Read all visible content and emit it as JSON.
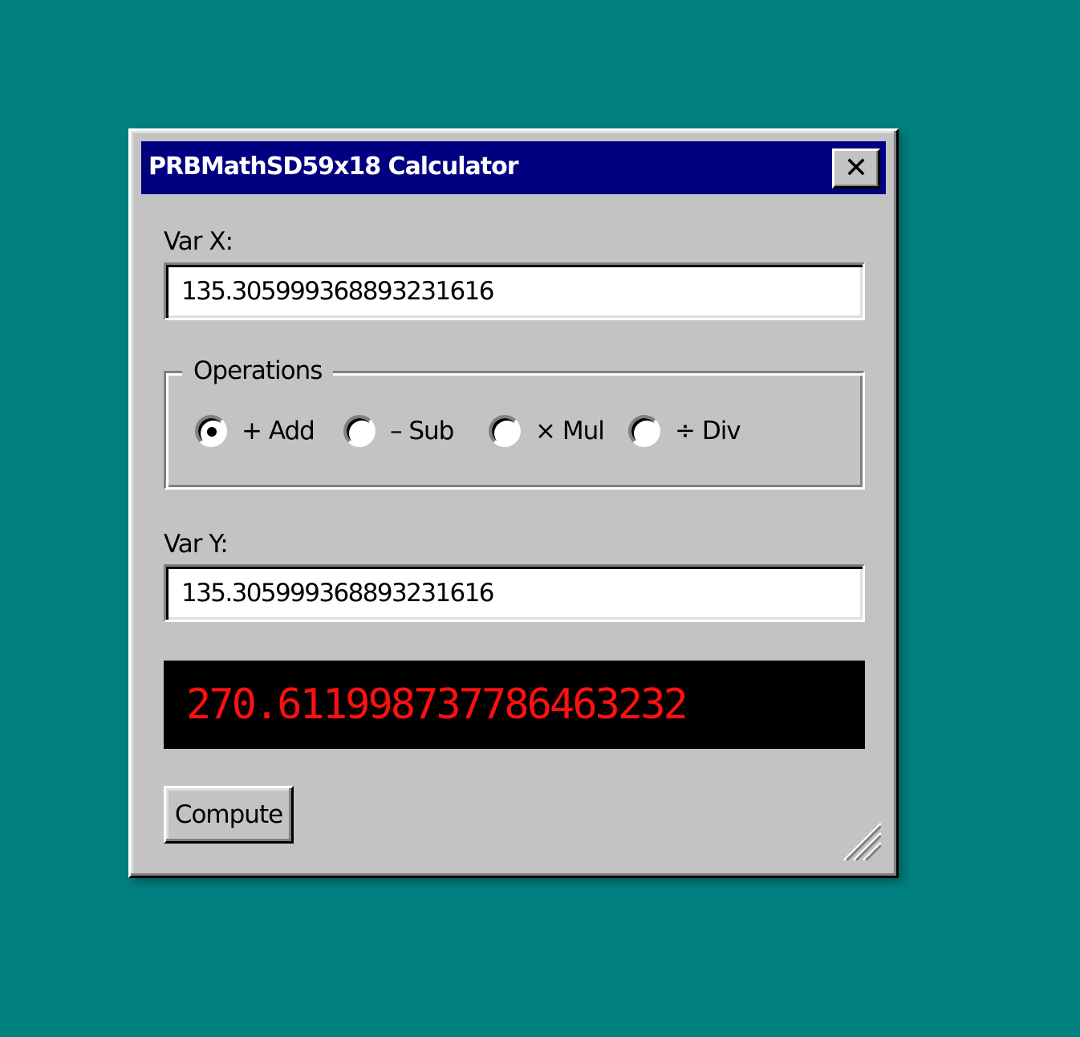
{
  "window": {
    "title": "PRBMathSD59x18 Calculator",
    "close_label": "✕"
  },
  "var_x": {
    "label": "Var X:",
    "value": "135.305999368893231616"
  },
  "operations": {
    "legend": "Operations",
    "selected": "add",
    "options": [
      {
        "id": "add",
        "label": "+ Add"
      },
      {
        "id": "sub",
        "label": "– Sub"
      },
      {
        "id": "mul",
        "label": "× Mul"
      },
      {
        "id": "div",
        "label": "÷ Div"
      }
    ]
  },
  "var_y": {
    "label": "Var Y:",
    "value": "135.305999368893231616"
  },
  "result": {
    "value": "270.611998737786463232"
  },
  "compute_button": {
    "label": "Compute"
  },
  "colors": {
    "desktop": "#008080",
    "titlebar": "#000080",
    "window_face": "#c3c3c3",
    "result_text": "#ff1010"
  }
}
